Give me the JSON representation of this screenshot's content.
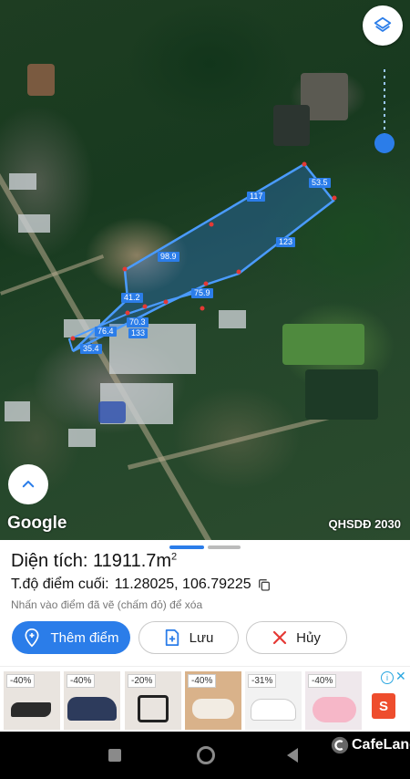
{
  "map": {
    "segment_labels": [
      "117",
      "53.5",
      "123",
      "98.9",
      "41.2",
      "75.9",
      "70.3",
      "76.4",
      "133",
      "35.4"
    ],
    "planning_tag": "QHSDĐ 2030",
    "google_logo": "Google",
    "layers_icon": "layers-icon",
    "collapse_icon": "chevron-up-icon"
  },
  "panel": {
    "area_label": "Diện tích:",
    "area_value": "11911.7m",
    "area_unit_sup": "2",
    "coord_label": "T.độ điểm cuối:",
    "coord_value": "11.28025, 106.79225",
    "hint": "Nhấn vào điểm đã vẽ (chấm đỏ) để xóa",
    "add_point_label": "Thêm điểm",
    "save_label": "Lưu",
    "cancel_label": "Hủy"
  },
  "ads": {
    "items": [
      {
        "badge": "-40%"
      },
      {
        "badge": "-40%"
      },
      {
        "badge": "-20%"
      },
      {
        "badge": "-40%"
      },
      {
        "badge": "-31%"
      },
      {
        "badge": "-40%"
      }
    ],
    "shop_glyph": "S"
  },
  "watermark": "CafeLand",
  "colors": {
    "accent": "#2b7de9",
    "ad_accent": "#ee4d2d"
  }
}
